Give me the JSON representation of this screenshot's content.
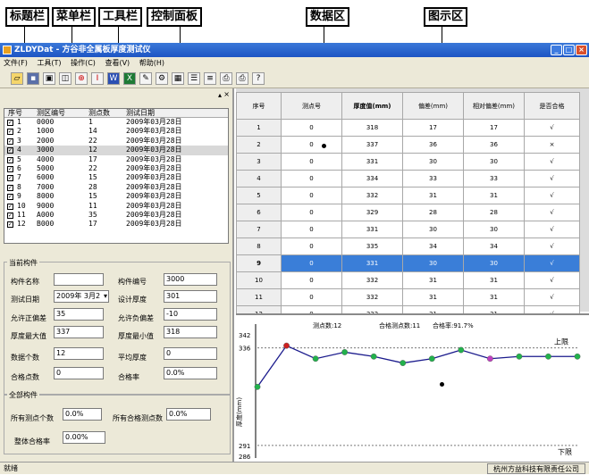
{
  "callouts": {
    "titlebar": "标题栏",
    "menubar": "菜单栏",
    "toolbar": "工具栏",
    "controlpanel": "控制面板",
    "dataarea": "数据区",
    "chartarea": "图示区"
  },
  "window": {
    "title": "ZLDYDat - 方谷非全属板厚度测试仪"
  },
  "menu": [
    "文件(F)",
    "工具(T)",
    "操作(C)",
    "查看(V)",
    "帮助(H)"
  ],
  "list": {
    "headers": [
      "序号",
      "测区编号",
      "测点数",
      "测试日期"
    ],
    "rows": [
      {
        "no": "1",
        "code": "0000",
        "pts": "1",
        "date": "2009年03月28日"
      },
      {
        "no": "2",
        "code": "1000",
        "pts": "14",
        "date": "2009年03月28日"
      },
      {
        "no": "3",
        "code": "2000",
        "pts": "22",
        "date": "2009年03月28日"
      },
      {
        "no": "4",
        "code": "3000",
        "pts": "12",
        "date": "2009年03月28日"
      },
      {
        "no": "5",
        "code": "4000",
        "pts": "17",
        "date": "2009年03月28日"
      },
      {
        "no": "6",
        "code": "5000",
        "pts": "22",
        "date": "2009年03月28日"
      },
      {
        "no": "7",
        "code": "6000",
        "pts": "15",
        "date": "2009年03月28日"
      },
      {
        "no": "8",
        "code": "7000",
        "pts": "28",
        "date": "2009年03月28日"
      },
      {
        "no": "9",
        "code": "8000",
        "pts": "15",
        "date": "2009年03月28日"
      },
      {
        "no": "10",
        "code": "9000",
        "pts": "11",
        "date": "2009年03月28日"
      },
      {
        "no": "11",
        "code": "A000",
        "pts": "35",
        "date": "2009年03月28日"
      },
      {
        "no": "12",
        "code": "B000",
        "pts": "17",
        "date": "2009年03月28日"
      }
    ]
  },
  "current": {
    "group": "当前构件",
    "name_label": "构件名称",
    "name": "",
    "code_label": "构件编号",
    "code": "3000",
    "date_label": "测试日期",
    "date": "2009年 3月2",
    "design_label": "设计厚度",
    "design": "301",
    "pos_tol_label": "允许正偏差",
    "pos_tol": "35",
    "neg_tol_label": "允许负偏差",
    "neg_tol": "-10",
    "max_label": "厚度最大值",
    "max": "337",
    "min_label": "厚度最小值",
    "min": "318",
    "count_label": "数据个数",
    "count": "12",
    "avg_label": "平均厚度",
    "avg": "0",
    "pass_pts_label": "合格点数",
    "pass_pts": "0",
    "pass_rate_label": "合格率",
    "pass_rate": "0.0%"
  },
  "all": {
    "group": "全部构件",
    "total_label": "所有测点个数",
    "total": "0.0%",
    "pass_label": "所有合格测点数",
    "pass": "0.0%",
    "rate_label": "整体合格率",
    "rate": "0.00%"
  },
  "grid": {
    "headers": [
      "序号",
      "测点号",
      "厚度值(mm)",
      "偏差(mm)",
      "相对偏差(mm)",
      "是否合格"
    ],
    "rows": [
      [
        "1",
        "0",
        "318",
        "17",
        "17",
        "√"
      ],
      [
        "2",
        "0",
        "337",
        "36",
        "36",
        "×"
      ],
      [
        "3",
        "0",
        "331",
        "30",
        "30",
        "√"
      ],
      [
        "4",
        "0",
        "334",
        "33",
        "33",
        "√"
      ],
      [
        "5",
        "0",
        "332",
        "31",
        "31",
        "√"
      ],
      [
        "6",
        "0",
        "329",
        "28",
        "28",
        "√"
      ],
      [
        "7",
        "0",
        "331",
        "30",
        "30",
        "√"
      ],
      [
        "8",
        "0",
        "335",
        "34",
        "34",
        "√"
      ],
      [
        "9",
        "0",
        "331",
        "30",
        "30",
        "√"
      ],
      [
        "10",
        "0",
        "332",
        "31",
        "31",
        "√"
      ],
      [
        "11",
        "0",
        "332",
        "31",
        "31",
        "√"
      ],
      [
        "12",
        "0",
        "332",
        "31",
        "31",
        "√"
      ]
    ],
    "selected_row": 8
  },
  "chart_data": {
    "type": "line",
    "x": [
      1,
      2,
      3,
      4,
      5,
      6,
      7,
      8,
      9,
      10,
      11,
      12
    ],
    "values": [
      318,
      337,
      331,
      334,
      332,
      329,
      331,
      335,
      331,
      332,
      332,
      332
    ],
    "ylim": [
      286,
      342
    ],
    "yticks": [
      "342",
      "336",
      "291",
      "286"
    ],
    "upper_limit": 336,
    "lower_limit": 291,
    "upper_label": "上限",
    "lower_label": "下限",
    "ylabel": "厚度(mm)",
    "summary": {
      "points": "测点数:12",
      "pass_points": "合格测点数:11",
      "pass_rate": "合格率:91.7%"
    },
    "line_color": "#1a1a8c",
    "point_color": "#22b14c",
    "fail_point_color": "#cc2020",
    "selected_point_color": "#c040c0",
    "selected_index": 8
  },
  "status": {
    "left": "就绪",
    "right": "杭州方益科技有限责任公司"
  }
}
